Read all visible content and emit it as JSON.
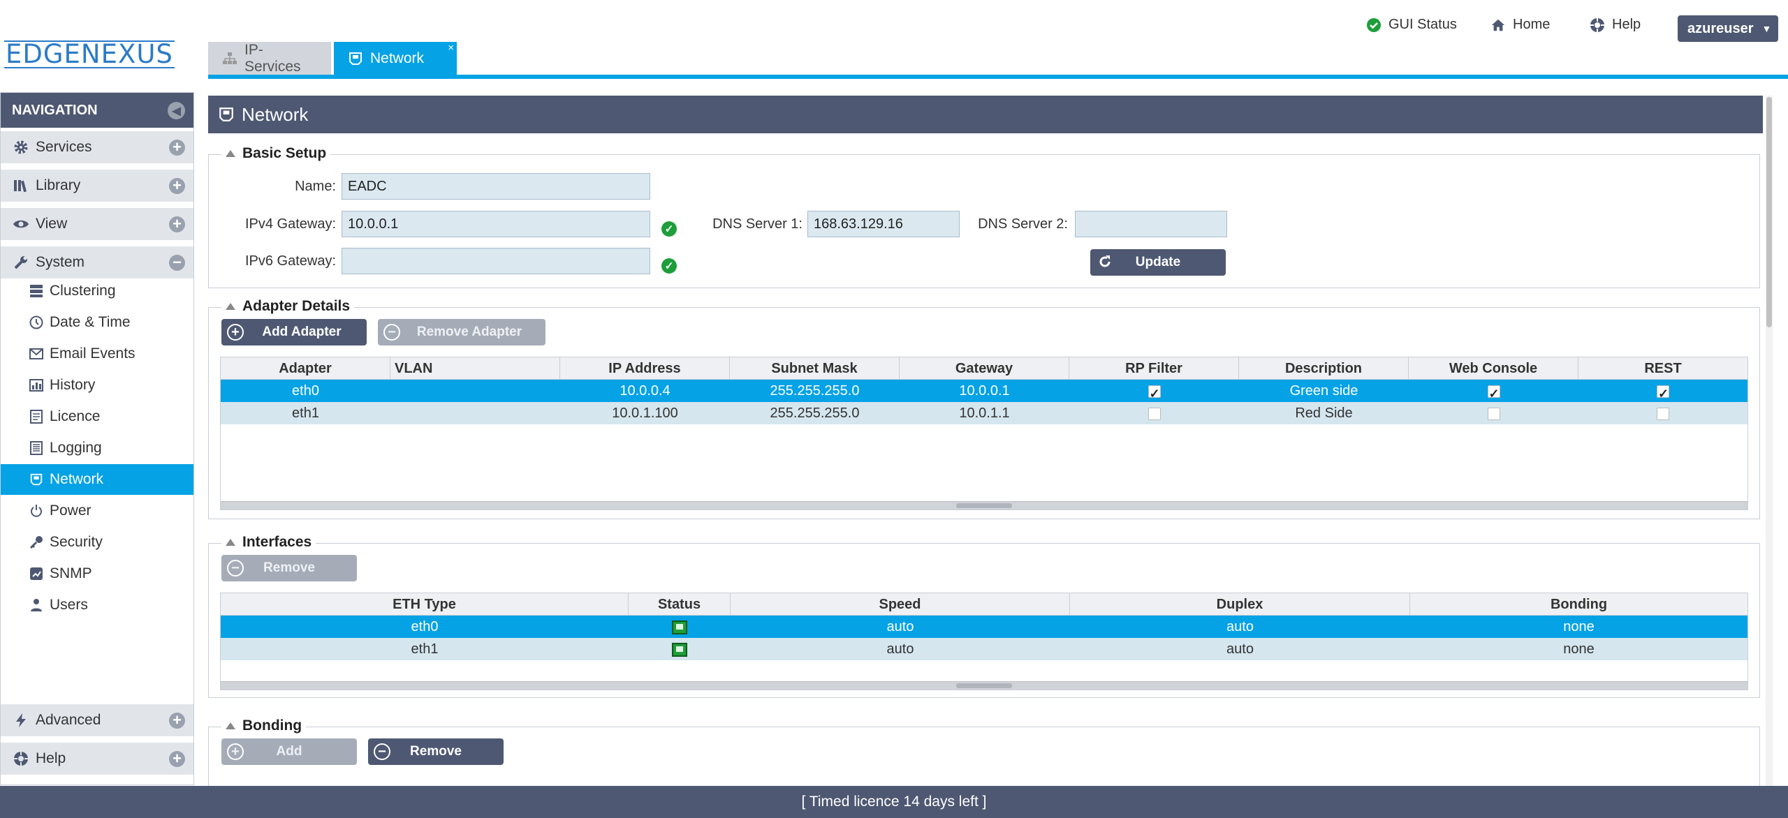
{
  "brand": {
    "logo_text": "EDGENEXUS"
  },
  "topnav": {
    "gui_status": "GUI Status",
    "home": "Home",
    "help": "Help",
    "user": "azureuser"
  },
  "tabs": [
    {
      "label": "IP-Services",
      "active": false
    },
    {
      "label": "Network",
      "active": true,
      "close": "×"
    }
  ],
  "navigation": {
    "title": "NAVIGATION",
    "sections": {
      "services": "Services",
      "library": "Library",
      "view": "View",
      "system": "System",
      "advanced": "Advanced",
      "help": "Help"
    },
    "system_items": [
      "Clustering",
      "Date & Time",
      "Email Events",
      "History",
      "Licence",
      "Logging",
      "Network",
      "Power",
      "Security",
      "SNMP",
      "Users"
    ],
    "selected": "Network"
  },
  "panel": {
    "title": "Network"
  },
  "basic_setup": {
    "legend": "Basic Setup",
    "name_label": "Name:",
    "name_value": "EADC",
    "ipv4_label": "IPv4 Gateway:",
    "ipv4_value": "10.0.0.1",
    "ipv6_label": "IPv6 Gateway:",
    "ipv6_value": "",
    "dns1_label": "DNS Server 1:",
    "dns1_value": "168.63.129.16",
    "dns2_label": "DNS Server 2:",
    "dns2_value": "",
    "update_button": "Update"
  },
  "adapter_details": {
    "legend": "Adapter Details",
    "add_button": "Add Adapter",
    "remove_button": "Remove Adapter",
    "columns": [
      "Adapter",
      "VLAN",
      "IP Address",
      "Subnet Mask",
      "Gateway",
      "RP Filter",
      "Description",
      "Web Console",
      "REST"
    ],
    "rows": [
      {
        "adapter": "eth0",
        "vlan": "",
        "ip": "10.0.0.4",
        "mask": "255.255.255.0",
        "gateway": "10.0.0.1",
        "rp_filter": true,
        "description": "Green side",
        "web_console": true,
        "rest": true
      },
      {
        "adapter": "eth1",
        "vlan": "",
        "ip": "10.0.1.100",
        "mask": "255.255.255.0",
        "gateway": "10.0.1.1",
        "rp_filter": false,
        "description": "Red Side",
        "web_console": false,
        "rest": false
      }
    ]
  },
  "interfaces": {
    "legend": "Interfaces",
    "remove_button": "Remove",
    "columns": [
      "ETH Type",
      "Status",
      "Speed",
      "Duplex",
      "Bonding"
    ],
    "rows": [
      {
        "eth": "eth0",
        "speed": "auto",
        "duplex": "auto",
        "bonding": "none"
      },
      {
        "eth": "eth1",
        "speed": "auto",
        "duplex": "auto",
        "bonding": "none"
      }
    ]
  },
  "bonding": {
    "legend": "Bonding",
    "add_button": "Add",
    "remove_button": "Remove"
  },
  "footer": {
    "text": "[ Timed licence 14 days left ]"
  },
  "colors": {
    "accent": "#05a2e6",
    "header": "#4e5872",
    "ok": "#1e9e3a"
  }
}
